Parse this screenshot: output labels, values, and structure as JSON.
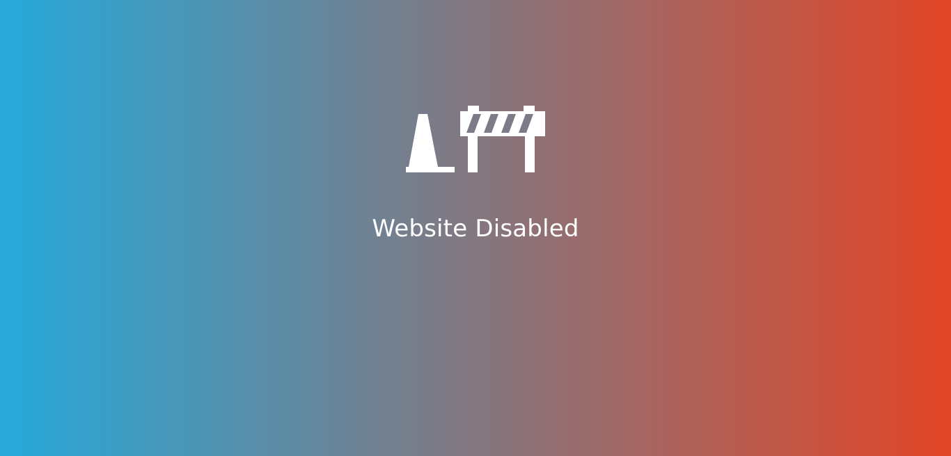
{
  "page": {
    "message": "Website Disabled",
    "icon": "construction-barrier-icon",
    "background_colors": [
      "#25a9da",
      "#e24526"
    ],
    "text_color": "#ffffff"
  }
}
